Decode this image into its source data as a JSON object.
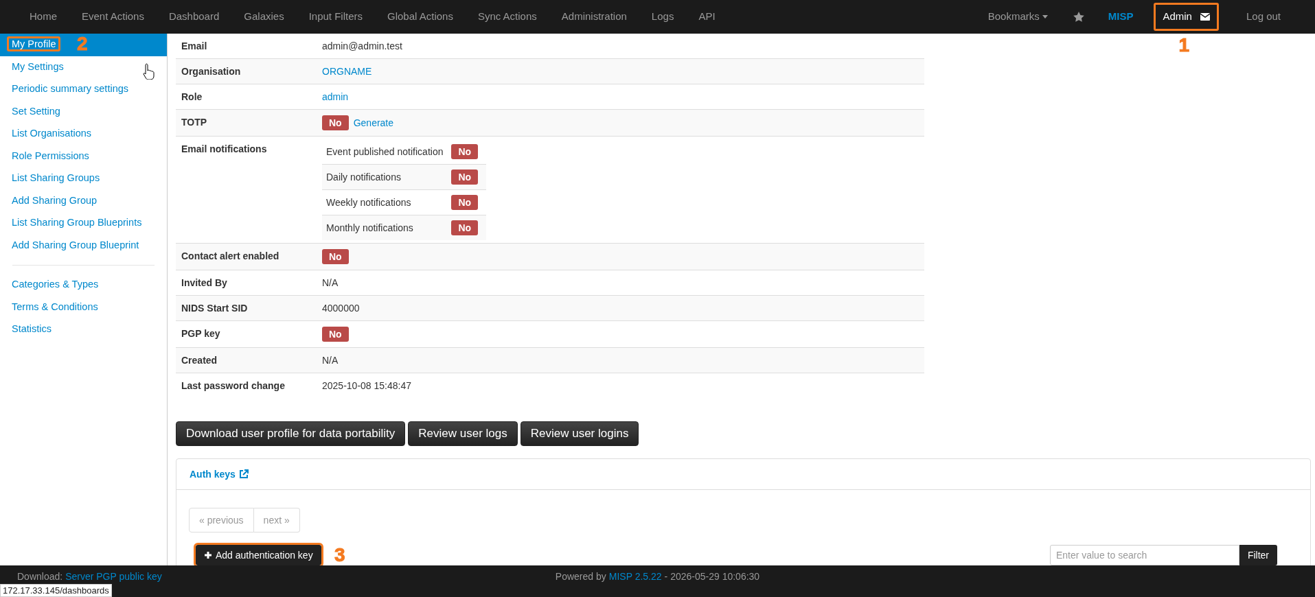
{
  "nav": {
    "items": [
      "Home",
      "Event Actions",
      "Dashboard",
      "Galaxies",
      "Input Filters",
      "Global Actions",
      "Sync Actions",
      "Administration",
      "Logs",
      "API"
    ],
    "bookmarks": "Bookmarks",
    "brand": "MISP",
    "user": {
      "label": "Admin",
      "annotation": "1"
    },
    "logout": "Log out"
  },
  "sidebar": {
    "groups": [
      [
        {
          "label": "My Profile",
          "selected": true,
          "annotation": "2"
        },
        {
          "label": "My Settings",
          "selected": false
        },
        {
          "label": "Periodic summary settings",
          "selected": false
        },
        {
          "label": "Set Setting",
          "selected": false
        },
        {
          "label": "List Organisations",
          "selected": false
        },
        {
          "label": "Role Permissions",
          "selected": false
        },
        {
          "label": "List Sharing Groups",
          "selected": false
        },
        {
          "label": "Add Sharing Group",
          "selected": false
        },
        {
          "label": "List Sharing Group Blueprints",
          "selected": false
        },
        {
          "label": "Add Sharing Group Blueprint",
          "selected": false
        }
      ],
      [
        {
          "label": "Categories & Types",
          "selected": false
        },
        {
          "label": "Terms & Conditions",
          "selected": false
        },
        {
          "label": "Statistics",
          "selected": false
        }
      ]
    ]
  },
  "profile": [
    {
      "label": "Email",
      "kind": "text",
      "value": "admin@admin.test"
    },
    {
      "label": "Organisation",
      "kind": "link",
      "value": "ORGNAME"
    },
    {
      "label": "Role",
      "kind": "link",
      "value": "admin"
    },
    {
      "label": "TOTP",
      "kind": "badge",
      "value": "No",
      "link": "Generate"
    },
    {
      "label": "Email notifications",
      "kind": "notifications",
      "notifications": [
        {
          "label": "Event published notification",
          "value": "No"
        },
        {
          "label": "Daily notifications",
          "value": "No"
        },
        {
          "label": "Weekly notifications",
          "value": "No"
        },
        {
          "label": "Monthly notifications",
          "value": "No"
        }
      ]
    },
    {
      "label": "Contact alert enabled",
      "kind": "badge",
      "value": "No"
    },
    {
      "label": "Invited By",
      "kind": "text",
      "value": "N/A"
    },
    {
      "label": "NIDS Start SID",
      "kind": "text",
      "value": "4000000"
    },
    {
      "label": "PGP key",
      "kind": "badge",
      "value": "No"
    },
    {
      "label": "Created",
      "kind": "text",
      "value": "N/A"
    },
    {
      "label": "Last password change",
      "kind": "text",
      "value": "2025-10-08 15:48:47"
    }
  ],
  "actions": [
    "Download user profile for data portability",
    "Review user logs",
    "Review user logins"
  ],
  "auth_keys": {
    "title": "Auth keys",
    "pagination": [
      "« previous",
      "next »"
    ],
    "add_button": {
      "label": "Add authentication key",
      "annotation": "3"
    },
    "search": {
      "placeholder": "Enter value to search"
    },
    "filter_button": "Filter"
  },
  "footer": {
    "download_label": "Download:",
    "download_link": "Server PGP public key",
    "powered_by": "Powered by",
    "version_link": "MISP 2.5.22",
    "timestamp": "- 2026-05-29 10:06:30"
  },
  "status_url": "172.17.33.145/dashboards"
}
